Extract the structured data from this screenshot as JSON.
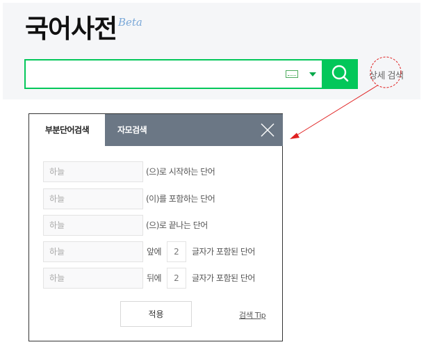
{
  "header": {
    "logo_text": "국어사전",
    "beta_label": "Beta"
  },
  "search": {
    "value": "",
    "keyboard_icon": "keyboard-icon",
    "dropdown_icon": "caret-down-icon",
    "search_icon": "magnifier-icon",
    "advanced_search_label": "상세 검색"
  },
  "dialog": {
    "tabs": [
      {
        "label": "부분단어검색",
        "active": true
      },
      {
        "label": "자모검색",
        "active": false
      }
    ],
    "close_icon": "close-icon",
    "rows": [
      {
        "placeholder": "하늘",
        "suffix": "(으)로 시작하는 단어"
      },
      {
        "placeholder": "하늘",
        "suffix": "(이)를 포함하는 단어"
      },
      {
        "placeholder": "하늘",
        "suffix": "(으)로 끝나는 단어"
      },
      {
        "placeholder": "하늘",
        "prefix": "앞에",
        "count": "2",
        "suffix": "글자가 포함된 단어"
      },
      {
        "placeholder": "하늘",
        "prefix": "뒤에",
        "count": "2",
        "suffix": "글자가 포함된 단어"
      }
    ],
    "apply_label": "적용",
    "tip_label": "검색 Tip"
  },
  "colors": {
    "brand_green": "#03c75a",
    "tab_bar": "#6b7785",
    "annotation_red": "#e02020"
  }
}
